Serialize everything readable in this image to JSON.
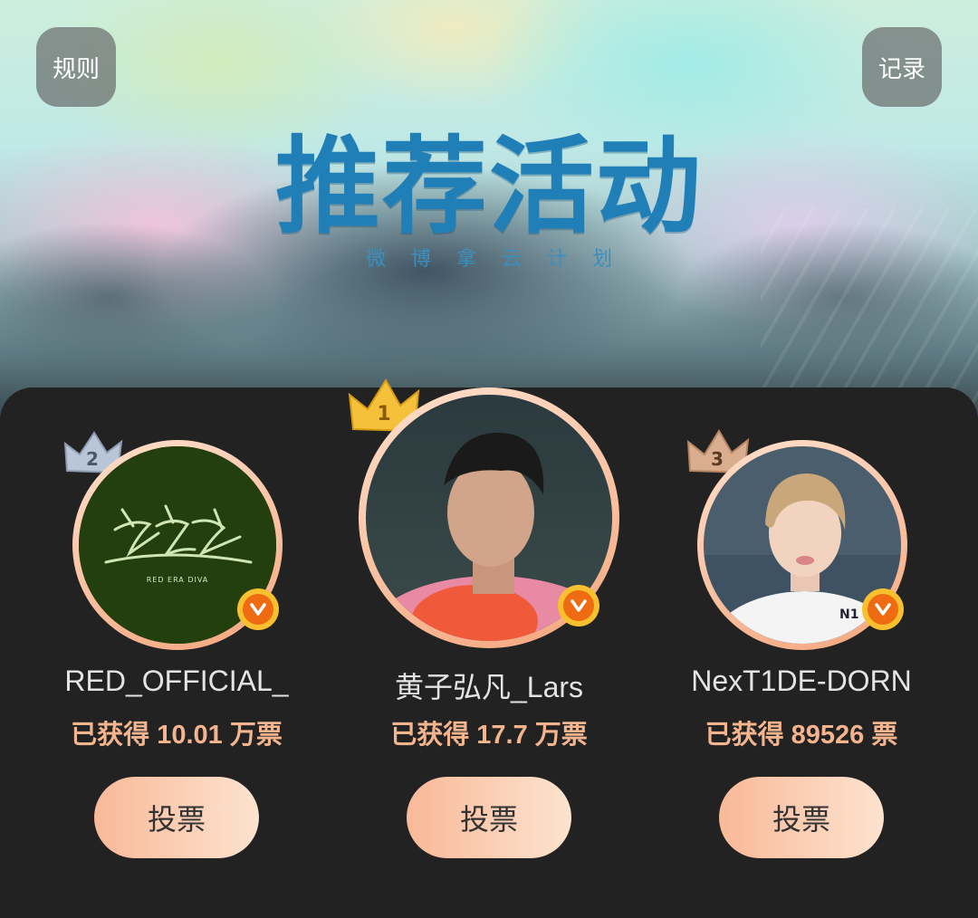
{
  "header": {
    "rules_label": "规则",
    "records_label": "记录",
    "title": "推荐活动",
    "subtitle": "微博拿云计划"
  },
  "candidates": [
    {
      "rank": "1",
      "name": "黄子弘凡_Lars",
      "votes": "已获得 17.7 万票",
      "vote_label": "投票"
    },
    {
      "rank": "2",
      "name": "RED_OFFICIAL_",
      "votes": "已获得 10.01 万票",
      "vote_label": "投票",
      "logo_text": "RED ERA DIVA"
    },
    {
      "rank": "3",
      "name": "NexT1DE-DORN",
      "votes": "已获得 89526 票",
      "vote_label": "投票",
      "shirt_text": "N1"
    }
  ],
  "colors": {
    "accent": "#f3b48e",
    "crown_gold": "#f5c13a",
    "crown_silver": "#b9c6d8",
    "crown_bronze": "#d9ad8d",
    "verified_badge": "#ee6b12",
    "title_blue": "#1f7fb6"
  },
  "icons": {
    "verified": "verified-v-icon",
    "rank": "crown-icon"
  }
}
